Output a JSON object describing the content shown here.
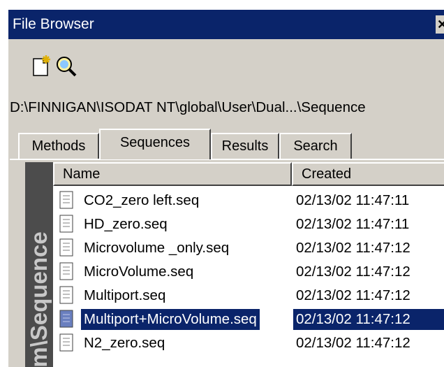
{
  "window": {
    "title": "File Browser",
    "close_glyph": "✕"
  },
  "toolbar": {
    "icons": [
      "new-file-icon",
      "search-icon"
    ]
  },
  "path": "D:\\FINNIGAN\\ISODAT NT\\global\\User\\Dual...\\Sequence",
  "tabs": [
    {
      "label": "Methods",
      "active": false
    },
    {
      "label": "Sequences",
      "active": true
    },
    {
      "label": "Results",
      "active": false
    },
    {
      "label": "Search",
      "active": false
    }
  ],
  "sidebar": {
    "label": "em\\Sequence"
  },
  "list": {
    "columns": {
      "name": "Name",
      "created": "Created"
    },
    "rows": [
      {
        "name": "CO2_zero left.seq",
        "created": "02/13/02 11:47:11",
        "selected": false
      },
      {
        "name": "HD_zero.seq",
        "created": "02/13/02 11:47:11",
        "selected": false
      },
      {
        "name": "Microvolume _only.seq",
        "created": "02/13/02 11:47:12",
        "selected": false
      },
      {
        "name": "MicroVolume.seq",
        "created": "02/13/02 11:47:12",
        "selected": false
      },
      {
        "name": "Multiport.seq",
        "created": "02/13/02 11:47:12",
        "selected": false
      },
      {
        "name": "Multiport+MicroVolume.seq",
        "created": "02/13/02 11:47:12",
        "selected": true
      },
      {
        "name": "N2_zero.seq",
        "created": "02/13/02 11:47:12",
        "selected": false
      }
    ]
  },
  "colors": {
    "titlebar": "#0a246a",
    "selection": "#0a246a",
    "face": "#d4d0c8"
  }
}
